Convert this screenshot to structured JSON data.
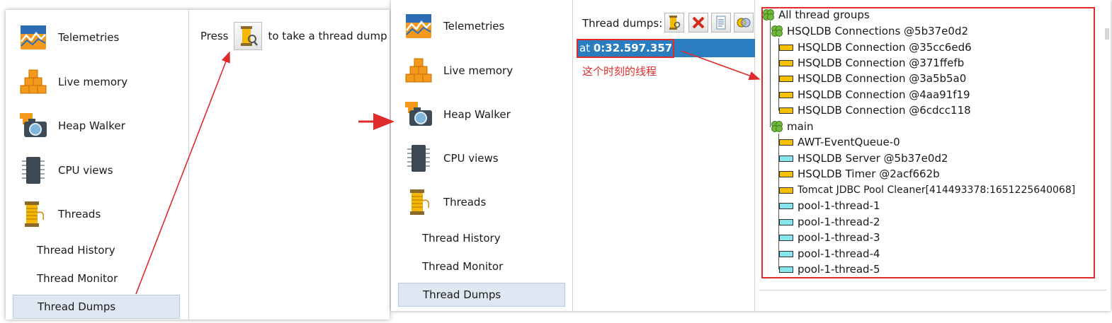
{
  "left_panel": {
    "nav": [
      {
        "label": "Telemetries",
        "icon": "telemetries-icon"
      },
      {
        "label": "Live memory",
        "icon": "live-memory-icon"
      },
      {
        "label": "Heap Walker",
        "icon": "heap-walker-icon"
      },
      {
        "label": "CPU views",
        "icon": "cpu-views-icon"
      },
      {
        "label": "Threads",
        "icon": "threads-icon"
      }
    ],
    "sub": [
      "Thread History",
      "Thread Monitor",
      "Thread Dumps"
    ],
    "press_prefix": "Press",
    "press_suffix": "to take a thread dump"
  },
  "right_panel": {
    "nav": [
      {
        "label": "Telemetries",
        "icon": "telemetries-icon"
      },
      {
        "label": "Live memory",
        "icon": "live-memory-icon"
      },
      {
        "label": "Heap Walker",
        "icon": "heap-walker-icon"
      },
      {
        "label": "CPU views",
        "icon": "cpu-views-icon"
      },
      {
        "label": "Threads",
        "icon": "threads-icon"
      }
    ],
    "sub": [
      "Thread History",
      "Thread Monitor",
      "Thread Dumps"
    ],
    "toolbar_label": "Thread dumps:",
    "dump_prefix": "at",
    "dump_time": "0:32.597.357",
    "annotation": "这个时刻的线程",
    "tree": {
      "root": "All thread groups",
      "groups": [
        {
          "name": "HSQLDB Connections @5b37e0d2",
          "threads": [
            {
              "name": "HSQLDB Connection @35cc6ed6",
              "state": "yellow"
            },
            {
              "name": "HSQLDB Connection @371ffefb",
              "state": "yellow"
            },
            {
              "name": "HSQLDB Connection @3a5b5a0",
              "state": "yellow"
            },
            {
              "name": "HSQLDB Connection @4aa91f19",
              "state": "yellow"
            },
            {
              "name": "HSQLDB Connection @6cdcc118",
              "state": "yellow"
            }
          ]
        },
        {
          "name": "main",
          "threads": [
            {
              "name": "AWT-EventQueue-0",
              "state": "yellow"
            },
            {
              "name": "HSQLDB Server @5b37e0d2",
              "state": "cyan"
            },
            {
              "name": "HSQLDB Timer @2acf662b",
              "state": "yellow"
            },
            {
              "name": "Tomcat JDBC Pool Cleaner[414493378:1651225640068]",
              "state": "yellow"
            },
            {
              "name": "pool-1-thread-1",
              "state": "cyan"
            },
            {
              "name": "pool-1-thread-2",
              "state": "cyan"
            },
            {
              "name": "pool-1-thread-3",
              "state": "cyan"
            },
            {
              "name": "pool-1-thread-4",
              "state": "cyan"
            },
            {
              "name": "pool-1-thread-5",
              "state": "cyan"
            }
          ]
        }
      ]
    }
  },
  "colors": {
    "annotation": "#e02b2b",
    "selection": "#2a7ec0",
    "running": "#f5c000",
    "waiting": "#86e6f0"
  }
}
